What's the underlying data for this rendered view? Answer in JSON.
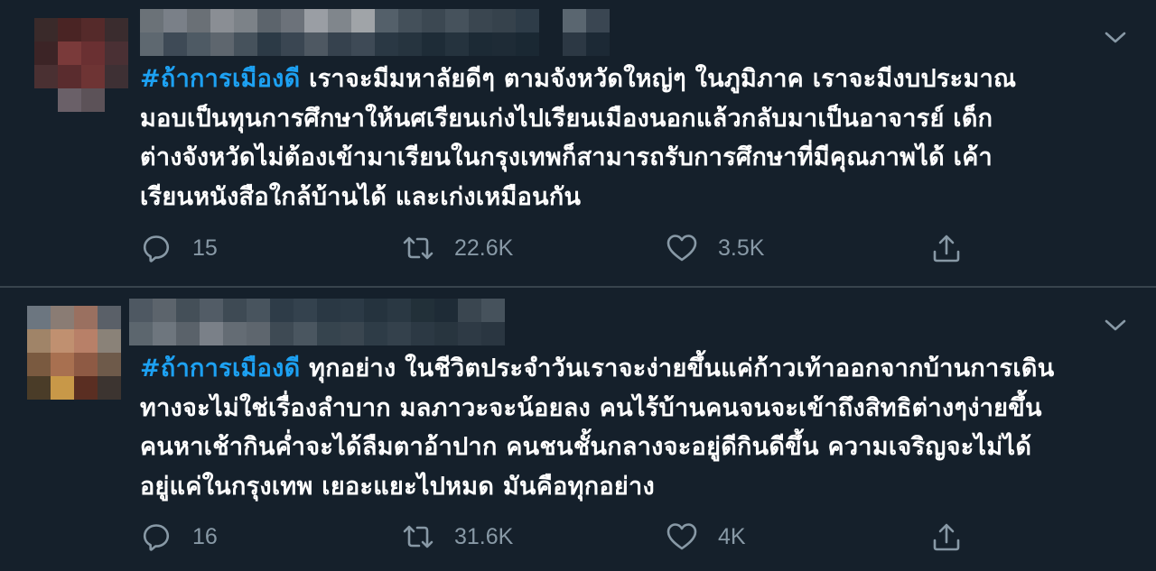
{
  "tweets": [
    {
      "hashtag": "#ถ้าการเมืองดี",
      "text": " เราจะมีมหาลัยดีๆ ตามจังหวัดใหญ่ๆ ในภูมิภาค เราจะมีงบประมาณ\nมอบเป็นทุนการศึกษาให้นศเรียนเก่งไปเรียนเมืองนอกแล้วกลับมาเป็นอาจารย์ เด็ก\nต่างจังหวัดไม่ต้องเข้ามาเรียนในกรุงเทพก็สามารถรับการศึกษาที่มีคุณภาพได้ เค้า\nเรียนหนังสือใกล้บ้านได้ และเก่งเหมือนกัน",
      "replies": "15",
      "retweets": "22.6K",
      "likes": "3.5K"
    },
    {
      "hashtag": "#ถ้าการเมืองดี",
      "text": " ทุกอย่าง ในชีวิตประจำวันเราจะง่ายขึ้นแค่ก้าวเท้าออกจากบ้านการเดิน\nทางจะไม่ใช่เรื่องลำบาก มลภาวะจะน้อยลง คนไร้บ้านคนจนจะเข้าถึงสิทธิต่างๆง่ายขึ้น\nคนหาเช้ากินค่ำจะได้ลืมตาอ้าปาก คนชนชั้นกลางจะอยู่ดีกินดีขึ้น ความเจริญจะไม่ได้\nอยู่แค่ในกรุงเทพ เยอะแยะไปหมด มันคือทุกอย่าง",
      "replies": "16",
      "retweets": "31.6K",
      "likes": "4K"
    }
  ],
  "icons": {
    "reply": "reply-icon",
    "retweet": "retweet-icon",
    "like": "heart-icon",
    "share": "share-icon",
    "more": "chevron-down-icon"
  },
  "colors": {
    "background": "#15202b",
    "text": "#ffffff",
    "hashtag": "#1da1f2",
    "secondary": "#8899a6",
    "divider": "#38444d"
  }
}
